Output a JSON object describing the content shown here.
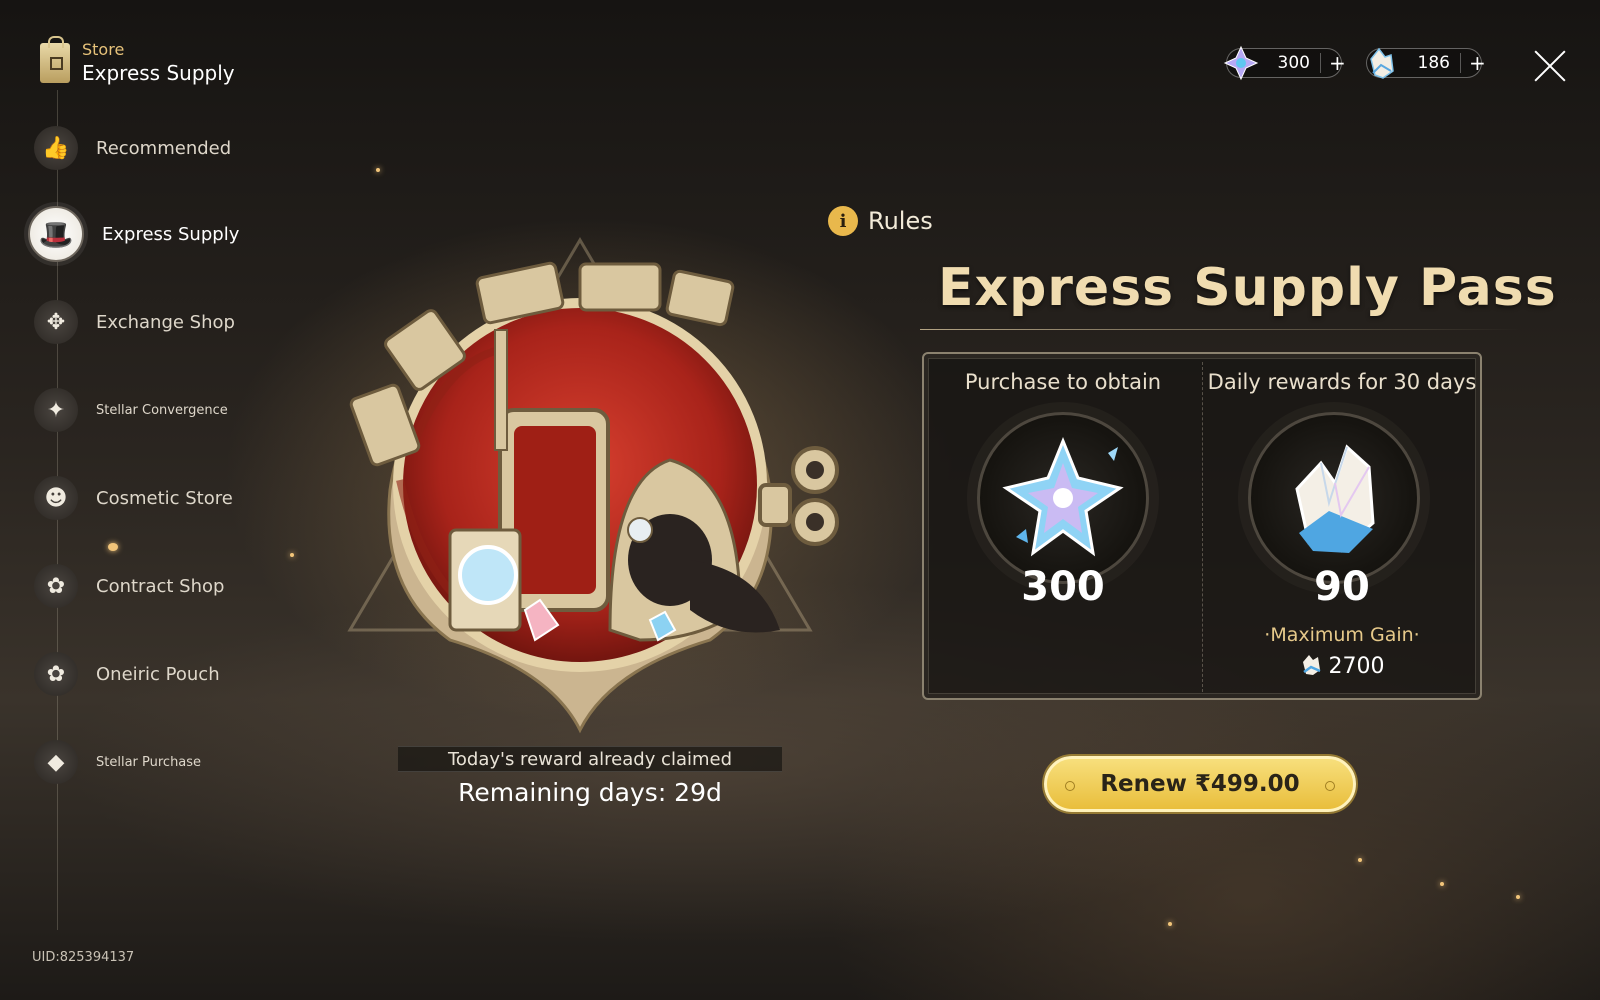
{
  "header": {
    "section": "Store",
    "title": "Express Supply"
  },
  "sidebar": {
    "items": [
      {
        "label": "Recommended",
        "icon": "thumbs-up-icon"
      },
      {
        "label": "Express Supply",
        "icon": "pom-pom-icon",
        "active": true
      },
      {
        "label": "Exchange Shop",
        "icon": "exchange-icon"
      },
      {
        "label": "Stellar Convergence",
        "icon": "convergence-icon"
      },
      {
        "label": "Cosmetic Store",
        "icon": "hat-icon"
      },
      {
        "label": "Contract Shop",
        "icon": "flower-icon"
      },
      {
        "label": "Oneiric Pouch",
        "icon": "flower-icon"
      },
      {
        "label": "Stellar Purchase",
        "icon": "crystal-icon"
      }
    ]
  },
  "uid": "UID:825394137",
  "currencies": [
    {
      "icon": "stellar-jade-icon",
      "value": "300",
      "plus": "+"
    },
    {
      "icon": "oneiric-shard-icon",
      "value": "186",
      "plus": "+"
    }
  ],
  "status": {
    "reward_claimed": "Today's reward already claimed",
    "remaining": "Remaining days: 29d"
  },
  "rules": {
    "label": "Rules"
  },
  "pass": {
    "title": "Express Supply Pass",
    "purchase_header": "Purchase to obtain",
    "purchase_value": "300",
    "daily_header": "Daily rewards for 30 days",
    "daily_value": "90",
    "max_gain_label": "·Maximum Gain·",
    "max_gain_value": "2700"
  },
  "renew": {
    "label": "Renew ₹499.00"
  },
  "colors": {
    "accent_gold": "#e9be3c",
    "title_gold": "#f0dcb0",
    "emblem_red": "#b5281d"
  }
}
